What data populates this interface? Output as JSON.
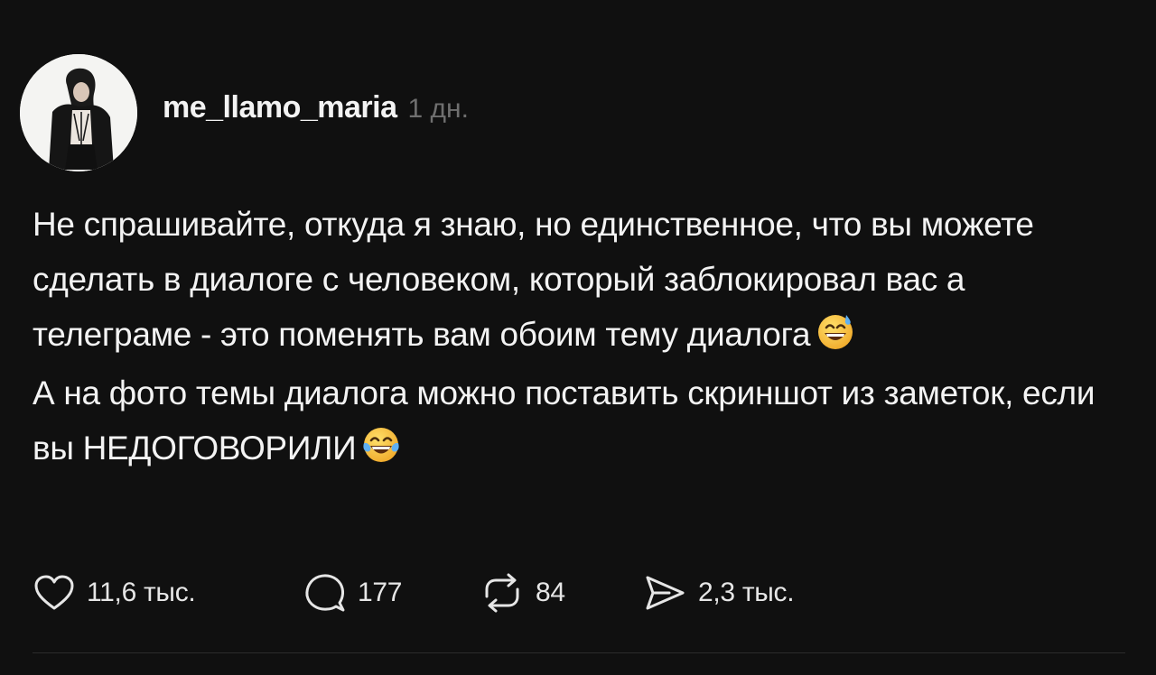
{
  "post": {
    "author": {
      "username": "me_llamo_maria",
      "timestamp": "1 дн."
    },
    "paragraphs": [
      {
        "text": "Не спрашивайте, откуда я знаю, но единственное, что вы можете сделать в диалоге с человеком, который заблокировал вас а телеграме - это поменять вам обоим тему диалога",
        "emoji": "grinning-face-with-sweat"
      },
      {
        "text": "А на фото темы диалога можно поставить скриншот из заметок, если вы НЕДОГОВОРИЛИ",
        "emoji": "face-with-tears-of-joy"
      }
    ],
    "actions": {
      "likes": {
        "icon": "heart-icon",
        "count": "11,6 тыс."
      },
      "replies": {
        "icon": "comment-icon",
        "count": "177"
      },
      "reposts": {
        "icon": "repost-icon",
        "count": "84"
      },
      "shares": {
        "icon": "send-icon",
        "count": "2,3 тыс."
      }
    }
  },
  "colors": {
    "background": "#101010",
    "text_primary": "#f3f3f3",
    "text_secondary": "#6f6f6f",
    "divider": "#2c2c2c",
    "emoji_face": "#f7c53a"
  }
}
